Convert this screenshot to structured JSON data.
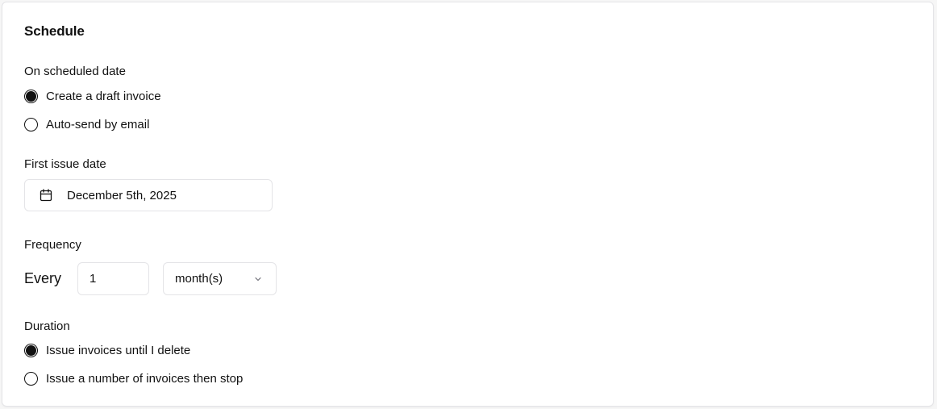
{
  "schedule": {
    "title": "Schedule",
    "on_scheduled_date": {
      "label": "On scheduled date",
      "options": [
        {
          "label": "Create a draft invoice",
          "checked": true
        },
        {
          "label": "Auto-send by email",
          "checked": false
        }
      ]
    },
    "first_issue_date": {
      "label": "First issue date",
      "value": "December 5th, 2025",
      "icon": "calendar-icon"
    },
    "frequency": {
      "label": "Frequency",
      "every_label": "Every",
      "interval_value": "1",
      "unit_value": "month(s)",
      "unit_icon": "chevron-down-icon"
    },
    "duration": {
      "label": "Duration",
      "options": [
        {
          "label": "Issue invoices until I delete",
          "checked": true
        },
        {
          "label": "Issue a number of invoices then stop",
          "checked": false
        }
      ]
    }
  },
  "colors": {
    "text": "#111111",
    "border": "#e4e4e7",
    "icon": "#111111",
    "chevron": "#71717a"
  }
}
